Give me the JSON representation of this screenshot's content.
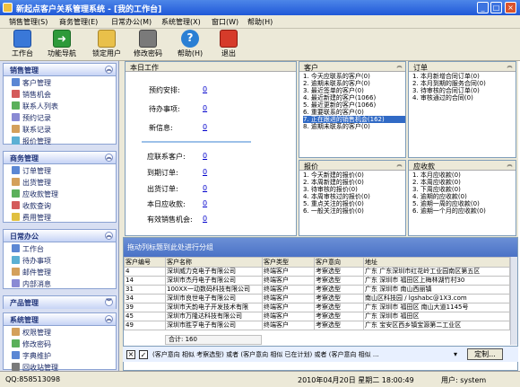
{
  "window": {
    "title": "新起点客户关系管理系统 - [我的工作台]"
  },
  "menubar": {
    "items": [
      "销售管理(S)",
      "商务管理(E)",
      "日常办公(M)",
      "系统管理(X)",
      "窗口(W)",
      "帮助(H)"
    ]
  },
  "toolbar": {
    "buttons": [
      {
        "label": "工作台",
        "icon": "workbench-icon"
      },
      {
        "label": "功能导航",
        "icon": "navigate-icon"
      },
      {
        "label": "锁定用户",
        "icon": "key-icon"
      },
      {
        "label": "修改密码",
        "icon": "password-icon"
      },
      {
        "label": "帮助(H)",
        "icon": "help-icon"
      },
      {
        "label": "退出",
        "icon": "exit-icon"
      }
    ]
  },
  "sidebar": {
    "groups": [
      {
        "title": "销售管理",
        "items": [
          "客户管理",
          "销售机会",
          "联系人列表",
          "预约记录",
          "联系记录",
          "报价管理"
        ]
      },
      {
        "title": "商务管理",
        "items": [
          "订单管理",
          "出货管理",
          "应收款管理",
          "收款查询",
          "费用管理"
        ]
      },
      {
        "title": "日常办公",
        "items": [
          "工作台",
          "待办事项",
          "邮件管理",
          "内部消息"
        ]
      },
      {
        "title": "产品管理",
        "items": []
      },
      {
        "title": "系统管理",
        "items": [
          "权限管理",
          "修改密码",
          "字典维护",
          "回收站管理"
        ]
      }
    ]
  },
  "today_panel": {
    "title": "本日工作",
    "rows1": [
      {
        "label": "预约安排:",
        "value": "0"
      },
      {
        "label": "待办事项:",
        "value": "0"
      },
      {
        "label": "新信息:",
        "value": "0"
      }
    ],
    "rows2": [
      {
        "label": "应联系客户:",
        "value": "0"
      },
      {
        "label": "到期订单:",
        "value": "0"
      },
      {
        "label": "出货订单:",
        "value": "0"
      },
      {
        "label": "本日应收款:",
        "value": "0"
      },
      {
        "label": "有效销售机会:",
        "value": "0"
      }
    ]
  },
  "customer_panel": {
    "title": "客户",
    "items": [
      "1. 今天应联系的客户(0)",
      "2. 逾期未联系的客户(0)",
      "3. 最近签单的客户(0)",
      "4. 最近新建的客户(1066)",
      "5. 最近更新的客户(1066)",
      "6. 重要联系的客户(0)",
      "7. 正在跟进的销售机会(162)",
      "8. 逾期未联系的客户(0)"
    ],
    "selected_index": 6
  },
  "order_panel": {
    "title": "订单",
    "items": [
      "1. 本月新增合同订单(0)",
      "2. 本月到期的服务合同(0)",
      "3. 待审核的合同订单(0)",
      "4. 审核通过的合同(0)"
    ]
  },
  "quote_panel": {
    "title": "报价",
    "items": [
      "1. 今天新建的报价(0)",
      "2. 本周新建的报价(0)",
      "3. 待审核的报价(0)",
      "4. 本周审核过的报价(0)",
      "5. 重点关注的报价(0)",
      "6. 一般关注的报价(0)"
    ]
  },
  "receivable_panel": {
    "title": "应收款",
    "items": [
      "1. 本月应收款(0)",
      "2. 本周应收款(0)",
      "3. 下周应收款(0)",
      "4. 逾期的应收款(0)",
      "5. 逾期一周的应收款(0)",
      "6. 逾期一个月的应收款(0)"
    ]
  },
  "grid": {
    "group_hint": "拖动列标题到此处进行分组",
    "columns": [
      "客户编号",
      "客户名称",
      "客户类型",
      "客户意向",
      "地址"
    ],
    "rows": [
      [
        "4",
        "深圳威力克电子有限公司",
        "终端客户",
        "考察选型",
        "广东 广东深圳市红花岭工业园南区第五区"
      ],
      [
        "14",
        "深圳市杰丹电子有限公司",
        "终端客户",
        "考察选型",
        "广东 深圳市 福田区上梅林湖竹村30"
      ],
      [
        "31",
        "100XX一动数码科技有限公司",
        "终端客户",
        "考察选型",
        "广东 深圳市 南山西丽镇"
      ],
      [
        "34",
        "深圳市良世电子有限公司",
        "终端客户",
        "考察选型",
        "南山区科技园 / lgshabc@1X3.com"
      ],
      [
        "39",
        "深圳市天韵电子开发技术有限",
        "终端客户",
        "考察选型",
        "广东 深圳市 福田区 南山大道1145号"
      ],
      [
        "45",
        "深圳市万隆达科技有限公司",
        "终端客户",
        "考察选型",
        "广东 深圳市 福田区"
      ],
      [
        "49",
        "深圳市胜亨电子有限公司",
        "终端客户",
        "考察选型",
        "广东 宝安区西乡镇宝源第二工业区"
      ]
    ],
    "total": "合计: 160",
    "filter_text": "(客户意向 相似 考察选型) 或者 (客户意向 相似 已在计划) 或者 (客户意向 相似 ...",
    "customize_label": "定制..."
  },
  "statusbar": {
    "qq": "QQ:858513098",
    "datetime": "2010年04月20日 星期二 18:00:49",
    "user": "用户: system"
  },
  "colors": {
    "titlebar": "#1f58d8",
    "selection": "#316ac5",
    "link": "#0000cc"
  }
}
